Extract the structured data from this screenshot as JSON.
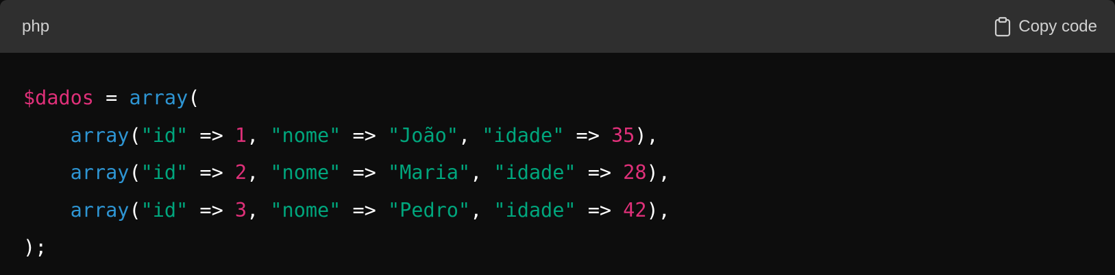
{
  "header": {
    "language": "php",
    "copy_label": "Copy code",
    "copy_icon": "clipboard-icon"
  },
  "colors": {
    "variable": "#df3079",
    "function": "#2e95d3",
    "string": "#00a67d",
    "number": "#df3079",
    "text": "#ffffff",
    "header_bg": "#2f2f2f",
    "code_bg": "#0d0d0d"
  },
  "code": {
    "line1": {
      "var": "$dados",
      "op": " = ",
      "fn": "array",
      "open": "("
    },
    "rows": [
      {
        "indent": "    ",
        "fn": "array",
        "p1": "(",
        "k1": "\"id\"",
        "a1": " => ",
        "v1": "1",
        "c1": ", ",
        "k2": "\"nome\"",
        "a2": " => ",
        "v2": "\"João\"",
        "c2": ", ",
        "k3": "\"idade\"",
        "a3": " => ",
        "v3": "35",
        "end": "),"
      },
      {
        "indent": "    ",
        "fn": "array",
        "p1": "(",
        "k1": "\"id\"",
        "a1": " => ",
        "v1": "2",
        "c1": ", ",
        "k2": "\"nome\"",
        "a2": " => ",
        "v2": "\"Maria\"",
        "c2": ", ",
        "k3": "\"idade\"",
        "a3": " => ",
        "v3": "28",
        "end": "),"
      },
      {
        "indent": "    ",
        "fn": "array",
        "p1": "(",
        "k1": "\"id\"",
        "a1": " => ",
        "v1": "3",
        "c1": ", ",
        "k2": "\"nome\"",
        "a2": " => ",
        "v2": "\"Pedro\"",
        "c2": ", ",
        "k3": "\"idade\"",
        "a3": " => ",
        "v3": "42",
        "end": "),"
      }
    ],
    "last": ");"
  }
}
